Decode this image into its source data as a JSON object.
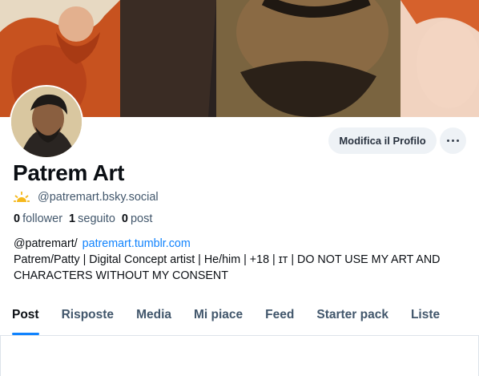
{
  "profile": {
    "display_name": "Patrem Art",
    "handle": "@patremart.bsky.social",
    "edit_label": "Modifica il Profilo",
    "more_label": "more options"
  },
  "stats": {
    "followers_count": "0",
    "followers_label": "follower",
    "following_count": "1",
    "following_label": "seguito",
    "posts_count": "0",
    "posts_label": "post"
  },
  "bio": {
    "prefix": "@patremart/",
    "link": "patremart.tumblr.com",
    "text": "Patrem/Patty | Digital Concept artist | He/him | +18 | ɪᴛ | DO NOT USE MY ART AND CHARACTERS WITHOUT MY CONSENT"
  },
  "tabs": [
    {
      "label": "Post",
      "active": true
    },
    {
      "label": "Risposte",
      "active": false
    },
    {
      "label": "Media",
      "active": false
    },
    {
      "label": "Mi piace",
      "active": false
    },
    {
      "label": "Feed",
      "active": false
    },
    {
      "label": "Starter pack",
      "active": false
    },
    {
      "label": "Liste",
      "active": false
    }
  ],
  "colors": {
    "accent": "#1083fe",
    "muted_text": "#42576c",
    "button_bg": "#eef2f6"
  },
  "icons": {
    "handle_badge": "sun-icon",
    "more": "ellipsis-icon"
  }
}
